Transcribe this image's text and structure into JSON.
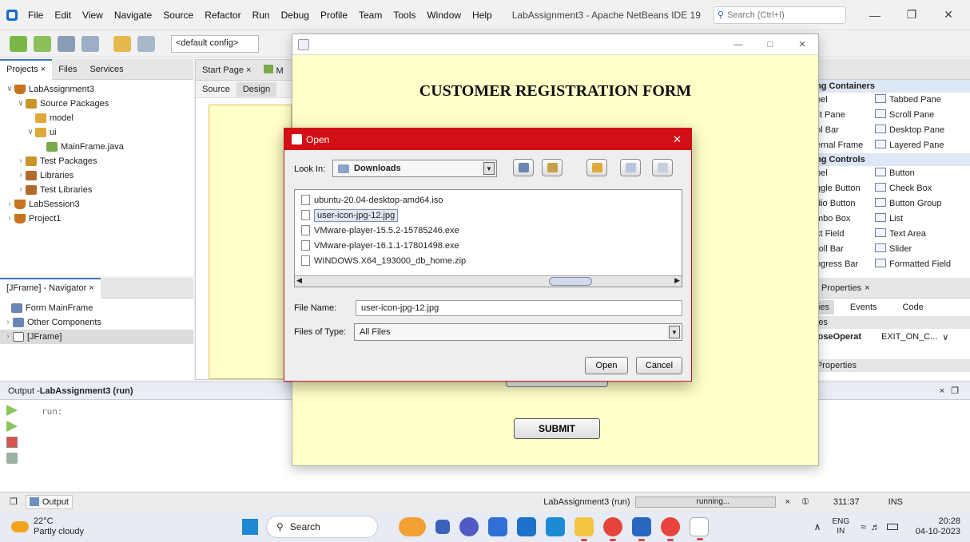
{
  "menubar": {
    "items": [
      "File",
      "Edit",
      "View",
      "Navigate",
      "Source",
      "Refactor",
      "Run",
      "Debug",
      "Profile",
      "Team",
      "Tools",
      "Window",
      "Help"
    ],
    "window_title": "LabAssignment3 - Apache NetBeans IDE 19",
    "search_placeholder": "Search (Ctrl+I)"
  },
  "toolbar": {
    "config": "<default config>"
  },
  "projects_panel": {
    "tabs": [
      "Projects",
      "Files",
      "Services"
    ],
    "tree": [
      {
        "label": "LabAssignment3",
        "icon": "cup"
      },
      {
        "label": "Source Packages",
        "icon": "pkgsrc"
      },
      {
        "label": "model",
        "icon": "pkg"
      },
      {
        "label": "ui",
        "icon": "pkg"
      },
      {
        "label": "MainFrame.java",
        "icon": "java"
      },
      {
        "label": "Test Packages",
        "icon": "pkgsrc"
      },
      {
        "label": "Libraries",
        "icon": "lib"
      },
      {
        "label": "Test Libraries",
        "icon": "lib"
      },
      {
        "label": "LabSession3",
        "icon": "cup"
      },
      {
        "label": "Project1",
        "icon": "cup"
      }
    ]
  },
  "navigator": {
    "title": "[JFrame] - Navigator",
    "items": [
      "Form MainFrame",
      "Other Components",
      "[JFrame]"
    ]
  },
  "editor": {
    "tabs": [
      "Start Page",
      "M"
    ],
    "subtabs": [
      "Source",
      "Design"
    ]
  },
  "palette": {
    "cat1": "ng Containers",
    "cat2": "ng Controls",
    "containers": [
      [
        "nel",
        "Tabbed Pane"
      ],
      [
        "lit Pane",
        "Scroll Pane"
      ],
      [
        "ol Bar",
        "Desktop Pane"
      ],
      [
        "ernal Frame",
        "Layered Pane"
      ]
    ],
    "controls": [
      [
        "bel",
        "Button"
      ],
      [
        "ggle Button",
        "Check Box"
      ],
      [
        "dio Button",
        "Button Group"
      ],
      [
        "mbo Box",
        "List"
      ],
      [
        "xt Field",
        "Text Area"
      ],
      [
        "roll Bar",
        "Slider"
      ],
      [
        "ogress Bar",
        "Formatted Field"
      ]
    ]
  },
  "properties": {
    "title": "e] - Properties",
    "tabs": [
      "erties",
      "Events",
      "Code"
    ],
    "section": "erties",
    "row_key": "tCloseOperat",
    "row_val": "EXIT_ON_C...",
    "other": "er Properties"
  },
  "output": {
    "title_prefix": "Output - ",
    "title_bold": "LabAssignment3 (run)",
    "text": "run:"
  },
  "statusbar": {
    "tab": "Output",
    "run_label": "LabAssignment3 (run)",
    "progress_text": "running...",
    "position": "311:37",
    "mode": "INS"
  },
  "taskbar": {
    "temp": "22°C",
    "weather": "Partly cloudy",
    "search": "Search",
    "lang1": "ENG",
    "lang2": "IN",
    "time": "20:28",
    "date": "04-10-2023"
  },
  "app_window": {
    "form_title": "CUSTOMER REGISTRATION FORM",
    "submit": "SUBMIT"
  },
  "dialog": {
    "title": "Open",
    "look_in_label": "Look In:",
    "look_in_value": "Downloads",
    "files": [
      "ubuntu-20.04-desktop-amd64.iso",
      "user-icon-jpg-12.jpg",
      "VMware-player-15.5.2-15785246.exe",
      "VMware-player-16.1.1-17801498.exe",
      "WINDOWS.X64_193000_db_home.zip"
    ],
    "selected_index": 1,
    "file_name_label": "File Name:",
    "file_name_value": "user-icon-jpg-12.jpg",
    "file_type_label": "Files of Type:",
    "file_type_value": "All Files",
    "open_button": "Open",
    "cancel_button": "Cancel"
  },
  "colors": {
    "dialog_title_bg": "#d20f14",
    "app_bg": "#ffffc8",
    "accent": "#3c76c4"
  }
}
